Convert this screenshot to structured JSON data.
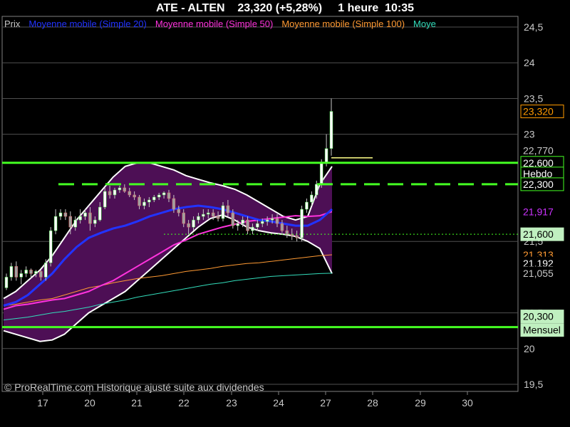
{
  "header": {
    "title": "ATE - ALTEN    23,320 (+5,28%)     1 heure  10:35"
  },
  "footer": {
    "copyright": "© ProRealTime.com Historique ajusté suite aux dividendes"
  },
  "chart_data": {
    "type": "candlestick",
    "ylim": [
      19.5,
      24.5
    ],
    "y_ticks": [
      {
        "v": 24.5,
        "label": "24,5"
      },
      {
        "v": 24,
        "label": "24"
      },
      {
        "v": 23.5,
        "label": "23,5"
      },
      {
        "v": 23,
        "label": "23"
      },
      {
        "v": 21.5,
        "label": "21,5"
      },
      {
        "v": 20.5,
        "label": "20,5"
      },
      {
        "v": 20,
        "label": "20"
      },
      {
        "v": 19.5,
        "label": "19,5"
      }
    ],
    "x_ticks": [
      "17",
      "20",
      "21",
      "22",
      "23",
      "24",
      "27",
      "28",
      "29",
      "30"
    ],
    "legend": [
      {
        "label": "Prix",
        "color": "#c8c8c8"
      },
      {
        "label": "Moyenne mobile (Simple 20)",
        "color": "#2233ff"
      },
      {
        "label": "Moyenne mobile (Simple 50)",
        "color": "#ff33dd"
      },
      {
        "label": "Moyenne mobile (Simple 100)",
        "color": "#ff9a33"
      },
      {
        "label": "Moye",
        "color": "#33ddbb"
      }
    ],
    "levels": [
      {
        "name": "Hebdo",
        "value": 22.6,
        "color": "#44ff22",
        "style": "solid"
      },
      {
        "name": "",
        "value": 22.3,
        "color": "#44ff22",
        "style": "dashed"
      },
      {
        "name": "Mensuel",
        "value": 20.3,
        "color": "#44ff22",
        "style": "solid"
      }
    ],
    "price_tags": [
      {
        "label": "23,320",
        "value": 23.32,
        "bg": "#000000",
        "fg": "#ff9a00",
        "border": "#ff9a00"
      },
      {
        "label": "22,770",
        "value": 22.77,
        "bg": "#000000",
        "fg": "#c8c8c8",
        "border": "#000000"
      },
      {
        "label": "22,600",
        "value": 22.6,
        "bg": "#000000",
        "fg": "#ffffff",
        "border": "#44ff22"
      },
      {
        "label": "Hebdo",
        "value": 22.45,
        "bg": "#000000",
        "fg": "#ffffff",
        "border": "#44ff22"
      },
      {
        "label": "22,300",
        "value": 22.3,
        "bg": "#000000",
        "fg": "#ffffff",
        "border": "#44ff22"
      },
      {
        "label": "21,917",
        "value": 21.917,
        "bg": "#000000",
        "fg": "#cc33ff",
        "border": "#000000"
      },
      {
        "label": "21,600",
        "value": 21.6,
        "bg": "#c0f0c0",
        "fg": "#000000",
        "border": "#c0f0c0"
      },
      {
        "label": "21,313",
        "value": 21.313,
        "bg": "#000000",
        "fg": "#ff9a33",
        "border": "#000000"
      },
      {
        "label": "21,192",
        "value": 21.192,
        "bg": "#000000",
        "fg": "#ffffff",
        "border": "#000000"
      },
      {
        "label": "21,055",
        "value": 21.055,
        "bg": "#000000",
        "fg": "#c8c8c8",
        "border": "#000000"
      },
      {
        "label": "20,300",
        "value": 20.45,
        "bg": "#c0f0c0",
        "fg": "#000000",
        "border": "#c0f0c0"
      },
      {
        "label": "Mensuel",
        "value": 20.26,
        "bg": "#c0f0c0",
        "fg": "#000000",
        "border": "#c0f0c0"
      }
    ],
    "candles": [
      [
        20.85,
        21.05,
        20.82,
        21.0
      ],
      [
        21.0,
        21.2,
        20.95,
        21.15
      ],
      [
        21.15,
        21.22,
        20.95,
        21.0
      ],
      [
        21.0,
        21.1,
        20.9,
        21.05
      ],
      [
        21.05,
        21.15,
        21.0,
        21.1
      ],
      [
        21.1,
        21.12,
        20.98,
        21.05
      ],
      [
        21.05,
        21.1,
        21.0,
        21.08
      ],
      [
        21.08,
        21.1,
        20.95,
        21.0
      ],
      [
        21.0,
        21.25,
        20.95,
        21.2
      ],
      [
        21.2,
        21.7,
        21.15,
        21.65
      ],
      [
        21.65,
        21.95,
        21.6,
        21.85
      ],
      [
        21.85,
        21.95,
        21.8,
        21.9
      ],
      [
        21.9,
        21.95,
        21.8,
        21.85
      ],
      [
        21.85,
        21.92,
        21.6,
        21.7
      ],
      [
        21.7,
        21.85,
        21.65,
        21.8
      ],
      [
        21.8,
        21.95,
        21.75,
        21.85
      ],
      [
        21.85,
        21.95,
        21.8,
        21.9
      ],
      [
        21.9,
        21.98,
        21.65,
        21.75
      ],
      [
        21.75,
        21.85,
        21.7,
        21.8
      ],
      [
        21.8,
        22.05,
        21.78,
        21.98
      ],
      [
        21.98,
        22.25,
        21.95,
        22.2
      ],
      [
        22.2,
        22.28,
        22.1,
        22.15
      ],
      [
        22.15,
        22.25,
        22.1,
        22.22
      ],
      [
        22.22,
        22.28,
        22.18,
        22.25
      ],
      [
        22.25,
        22.3,
        22.18,
        22.2
      ],
      [
        22.2,
        22.25,
        22.12,
        22.15
      ],
      [
        22.15,
        22.2,
        22.08,
        22.12
      ],
      [
        22.12,
        22.15,
        21.95,
        22.0
      ],
      [
        22.0,
        22.1,
        21.95,
        22.05
      ],
      [
        22.05,
        22.12,
        21.98,
        22.08
      ],
      [
        22.08,
        22.15,
        22.05,
        22.12
      ],
      [
        22.12,
        22.18,
        22.08,
        22.15
      ],
      [
        22.15,
        22.2,
        22.1,
        22.18
      ],
      [
        22.18,
        22.22,
        22.05,
        22.1
      ],
      [
        22.1,
        22.15,
        21.9,
        21.95
      ],
      [
        21.95,
        22.0,
        21.85,
        21.9
      ],
      [
        21.9,
        21.95,
        21.7,
        21.75
      ],
      [
        21.75,
        21.8,
        21.6,
        21.7
      ],
      [
        21.7,
        21.85,
        21.65,
        21.8
      ],
      [
        21.8,
        21.9,
        21.75,
        21.85
      ],
      [
        21.85,
        21.95,
        21.8,
        21.88
      ],
      [
        21.88,
        21.95,
        21.82,
        21.9
      ],
      [
        21.9,
        21.95,
        21.8,
        21.85
      ],
      [
        21.85,
        21.92,
        21.78,
        21.82
      ],
      [
        21.82,
        22.05,
        21.78,
        22.0
      ],
      [
        22.0,
        22.08,
        21.85,
        21.9
      ],
      [
        21.9,
        21.95,
        21.68,
        21.72
      ],
      [
        21.72,
        21.8,
        21.65,
        21.75
      ],
      [
        21.75,
        21.85,
        21.7,
        21.8
      ],
      [
        21.8,
        21.85,
        21.6,
        21.65
      ],
      [
        21.65,
        21.75,
        21.6,
        21.7
      ],
      [
        21.7,
        21.8,
        21.65,
        21.75
      ],
      [
        21.75,
        21.82,
        21.7,
        21.78
      ],
      [
        21.78,
        21.85,
        21.72,
        21.8
      ],
      [
        21.8,
        21.88,
        21.75,
        21.82
      ],
      [
        21.82,
        21.88,
        21.7,
        21.75
      ],
      [
        21.75,
        21.8,
        21.62,
        21.65
      ],
      [
        21.65,
        21.72,
        21.55,
        21.6
      ],
      [
        21.6,
        21.68,
        21.52,
        21.58
      ],
      [
        21.58,
        21.65,
        21.5,
        21.55
      ],
      [
        21.55,
        22.0,
        21.5,
        21.95
      ],
      [
        21.95,
        22.1,
        21.9,
        22.05
      ],
      [
        22.05,
        22.2,
        22.0,
        22.15
      ],
      [
        22.15,
        22.35,
        22.1,
        22.3
      ],
      [
        22.3,
        22.65,
        22.25,
        22.6
      ],
      [
        22.6,
        23.0,
        22.55,
        22.8
      ],
      [
        22.8,
        23.5,
        22.7,
        23.32
      ]
    ],
    "series": {
      "boll_upper": [
        20.7,
        20.8,
        20.95,
        21.1,
        21.3,
        21.55,
        21.8,
        22.0,
        22.2,
        22.4,
        22.55,
        22.6,
        22.6,
        22.55,
        22.5,
        22.42,
        22.37,
        22.32,
        22.28,
        22.23,
        22.15,
        22.05,
        21.95,
        21.85,
        21.8,
        21.85,
        22.3,
        22.55
      ],
      "boll_lower": [
        20.25,
        20.2,
        20.15,
        20.1,
        20.12,
        20.2,
        20.35,
        20.5,
        20.6,
        20.7,
        20.8,
        20.95,
        21.1,
        21.25,
        21.4,
        21.55,
        21.7,
        21.82,
        21.87,
        21.8,
        21.7,
        21.65,
        21.62,
        21.6,
        21.57,
        21.5,
        21.4,
        21.05
      ],
      "ma20": [
        20.6,
        20.65,
        20.75,
        20.9,
        21.05,
        21.25,
        21.42,
        21.55,
        21.62,
        21.68,
        21.72,
        21.78,
        21.85,
        21.9,
        21.95,
        21.98,
        22.0,
        21.98,
        21.95,
        21.9,
        21.85,
        21.8,
        21.78,
        21.75,
        21.72,
        21.72,
        21.8,
        21.95
      ],
      "ma50": [
        20.55,
        20.6,
        20.62,
        20.65,
        20.68,
        20.7,
        20.75,
        20.8,
        20.88,
        20.95,
        21.05,
        21.15,
        21.25,
        21.35,
        21.45,
        21.52,
        21.6,
        21.65,
        21.7,
        21.74,
        21.78,
        21.8,
        21.82,
        21.84,
        21.86,
        21.85,
        21.86,
        21.917
      ],
      "ma100": [
        20.6,
        20.62,
        20.65,
        20.68,
        20.7,
        20.75,
        20.8,
        20.85,
        20.88,
        20.92,
        20.95,
        20.98,
        21.0,
        21.02,
        21.05,
        21.08,
        21.1,
        21.12,
        21.15,
        21.17,
        21.19,
        21.2,
        21.22,
        21.24,
        21.26,
        21.28,
        21.3,
        21.313
      ],
      "ma200": [
        20.4,
        20.42,
        20.44,
        20.47,
        20.5,
        20.52,
        20.55,
        20.58,
        20.62,
        20.65,
        20.68,
        20.72,
        20.75,
        20.78,
        20.81,
        20.84,
        20.87,
        20.9,
        20.92,
        20.95,
        20.97,
        20.99,
        21.01,
        21.02,
        21.03,
        21.04,
        21.05,
        21.055
      ],
      "series_colors": {
        "boll": "#ffffff",
        "ma20": "#2233ff",
        "ma50": "#ff33dd",
        "ma100": "#ff9a33",
        "ma200": "#33ddbb",
        "fill": "#4d0f55"
      }
    },
    "dotted_level": {
      "value": 21.6,
      "color": "#44ff22"
    },
    "yellow_level": {
      "value": 22.67,
      "color": "#ffff88"
    }
  }
}
